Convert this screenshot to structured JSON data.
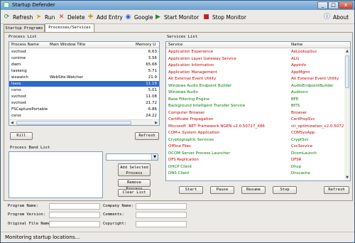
{
  "window": {
    "title": "Startup Defender",
    "min": "_",
    "max": "□",
    "close": "x"
  },
  "toolbar": {
    "refresh": "Refresh",
    "run": "Run",
    "delete": "Delete",
    "add_entry": "Add Entry",
    "google": "Google",
    "start_monitor": "Start Monitor",
    "stop_monitor": "Stop Monitor",
    "about": "About"
  },
  "tabs": [
    {
      "label": "Startup Programs"
    },
    {
      "label": "Processes/Services"
    }
  ],
  "process_list": {
    "label": "Process List",
    "columns": [
      "Process Name",
      "Main Window Title",
      "Memory U"
    ],
    "rows": [
      {
        "name": "svchost",
        "title": "",
        "mem": "6.63"
      },
      {
        "name": "conime",
        "title": "",
        "mem": "3.56"
      },
      {
        "name": "dwm",
        "title": "",
        "mem": "65.68"
      },
      {
        "name": "taskeng",
        "title": "",
        "mem": "5.71"
      },
      {
        "name": "wswatch",
        "title": "WebSite-Watcher",
        "mem": "21.9"
      },
      {
        "name": "lsass",
        "title": "",
        "mem": "11.19"
      },
      {
        "name": "csrss",
        "title": "",
        "mem": "5.01"
      },
      {
        "name": "svchost",
        "title": "",
        "mem": "11.08"
      },
      {
        "name": "svchost",
        "title": "",
        "mem": "21.72"
      },
      {
        "name": "FSCapturePortable",
        "title": "",
        "mem": "6.86"
      },
      {
        "name": "csrss",
        "title": "",
        "mem": "24.22"
      }
    ],
    "selected_index": 5,
    "kill": "Kill",
    "refresh": "Refresh"
  },
  "process_band": {
    "label": "Process Band List",
    "add": "Add Selected Process",
    "remove": "Remove Process",
    "clear": "Clear List"
  },
  "services_list": {
    "label": "Services List",
    "columns": [
      "Service",
      "Name"
    ],
    "rows": [
      {
        "service": "Application Experience",
        "name": "AeLookupSvc",
        "status": "stopped"
      },
      {
        "service": "Application Layer Gateway Service",
        "name": "ALG",
        "status": "stopped"
      },
      {
        "service": "Application Information",
        "name": "Appinfo",
        "status": "stopped"
      },
      {
        "service": "Application Management",
        "name": "AppMgmt",
        "status": "stopped"
      },
      {
        "service": "Ati External Event Utility",
        "name": "Ati External Event Utility",
        "status": "stopped"
      },
      {
        "service": "Windows Audio Endpoint Builder",
        "name": "AudioEndpointBuilder",
        "status": "running"
      },
      {
        "service": "Windows Audio",
        "name": "Audiosrv",
        "status": "running"
      },
      {
        "service": "Base Filtering Engine",
        "name": "BFE",
        "status": "running"
      },
      {
        "service": "Background Intelligent Transfer Service",
        "name": "BITS",
        "status": "running"
      },
      {
        "service": "Computer Browser",
        "name": "Browser",
        "status": "stopped"
      },
      {
        "service": "Certificate Propagation",
        "name": "CertPropSvc",
        "status": "stopped"
      },
      {
        "service": "Microsoft .NET Framework NGEN v2.0.50727_X86",
        "name": "clr_optimization_v2.0.50727_",
        "status": "stopped"
      },
      {
        "service": "COM+ System Application",
        "name": "COMSysApp",
        "status": "stopped"
      },
      {
        "service": "Cryptographic Services",
        "name": "CryptSvc",
        "status": "running"
      },
      {
        "service": "Offline Files",
        "name": "CscService",
        "status": "stopped"
      },
      {
        "service": "DCOM Server Process Launcher",
        "name": "DcomLaunch",
        "status": "running"
      },
      {
        "service": "DFS Replication",
        "name": "DFSR",
        "status": "stopped"
      },
      {
        "service": "DHCP Client",
        "name": "Dhcp",
        "status": "running"
      },
      {
        "service": "DNS Client",
        "name": "Dnscache",
        "status": "running"
      }
    ],
    "start": "Start",
    "pause": "Pause",
    "resume": "Resume",
    "stop": "Stop",
    "refresh": "Refresh"
  },
  "info": {
    "program_name": "Program Name:",
    "program_version": "Program Version:",
    "original_file_name": "Original File Name:",
    "company_name": "Company Name:",
    "comments": "Comments:",
    "copyright": "Copyright:"
  },
  "status": {
    "text": "Monitoring startup locations..."
  },
  "colors": {
    "stopped": "#c00000",
    "running": "#007a00",
    "selection": "#3169c6"
  }
}
